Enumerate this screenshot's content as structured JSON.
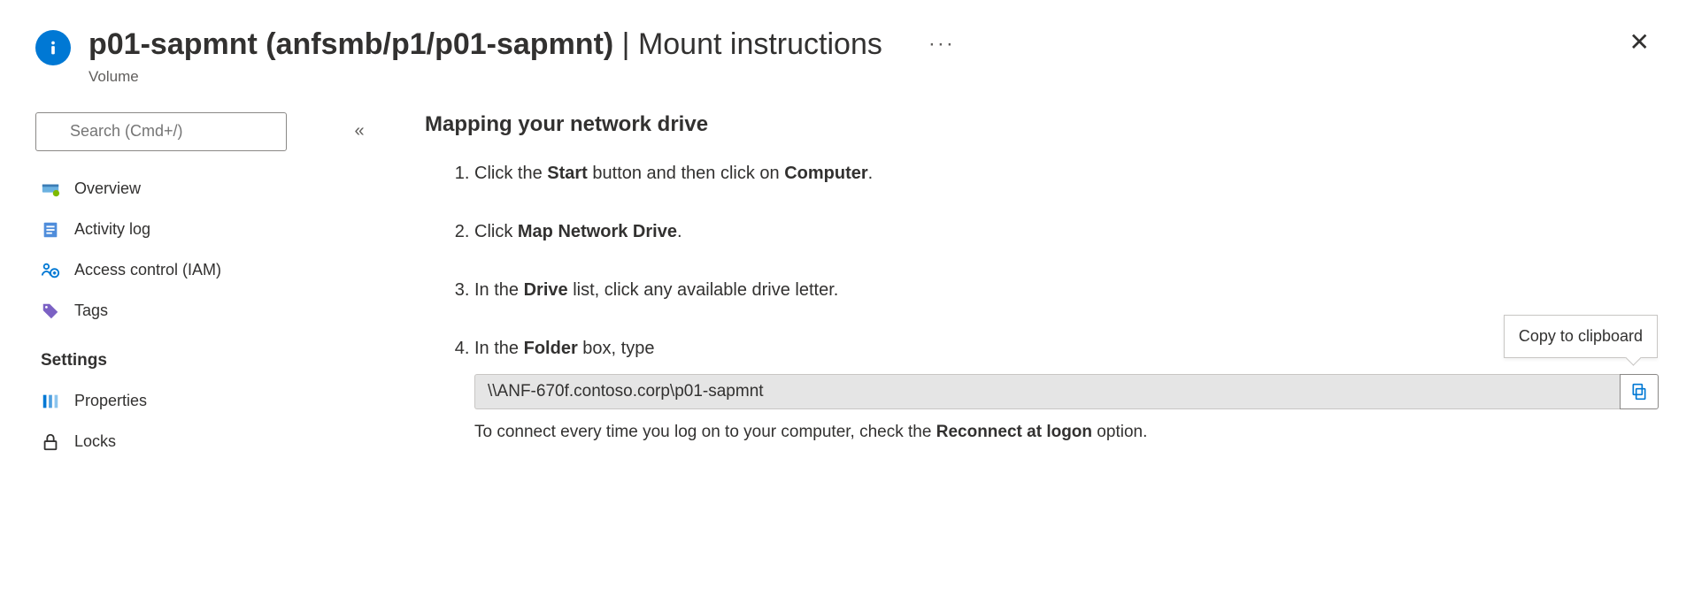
{
  "header": {
    "title_bold": "p01-sapmnt (anfsmb/p1/p01-sapmnt)",
    "title_thin": "Mount instructions",
    "subtitle": "Volume",
    "ellipsis": "···"
  },
  "sidebar": {
    "search_placeholder": "Search (Cmd+/)",
    "items": [
      {
        "label": "Overview"
      },
      {
        "label": "Activity log"
      },
      {
        "label": "Access control (IAM)"
      },
      {
        "label": "Tags"
      }
    ],
    "settings_head": "Settings",
    "settings_items": [
      {
        "label": "Properties"
      },
      {
        "label": "Locks"
      }
    ]
  },
  "content": {
    "heading": "Mapping your network drive",
    "step1_pre": "Click the ",
    "step1_b1": "Start",
    "step1_mid": " button and then click on ",
    "step1_b2": "Computer",
    "step1_post": ".",
    "step2_pre": "Click ",
    "step2_b1": "Map Network Drive",
    "step2_post": ".",
    "step3_pre": "In the ",
    "step3_b1": "Drive",
    "step3_post": " list, click any available drive letter.",
    "step4_pre": "In the ",
    "step4_b1": "Folder",
    "step4_post": " box, type",
    "path_value": "\\\\ANF-670f.contoso.corp\\p01-sapmnt",
    "tooltip": "Copy to clipboard",
    "note_pre": "To connect every time you log on to your computer, check the ",
    "note_b": "Reconnect at logon",
    "note_post": " option."
  }
}
